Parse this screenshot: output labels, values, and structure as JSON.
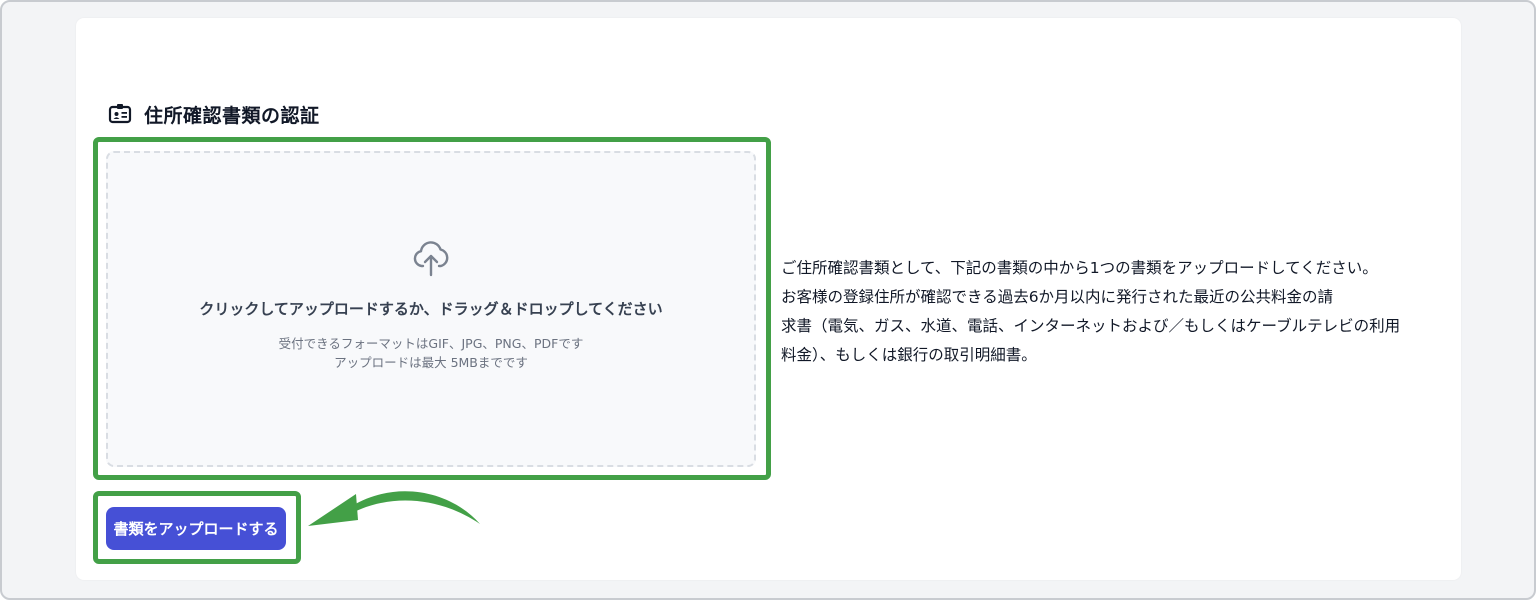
{
  "section": {
    "icon": "id-card-icon",
    "title": "住所確認書類の認証"
  },
  "dropzone": {
    "icon": "cloud-upload-icon",
    "main_text": "クリックしてアップロードするか、ドラッグ＆ドロップしてください",
    "formats_text": "受付できるフォーマットはGIF、JPG、PNG、PDFです",
    "size_text": "アップロードは最大 5MBまでです"
  },
  "upload_button": {
    "label": "書類をアップロードする"
  },
  "description": {
    "lines": [
      "ご住所確認書類として、下記の書類の中から1つの書類をアップロードしてください。",
      "お客様の登録住所が確認できる過去6か月以内に発行された最近の公共料金の請",
      "求書（電気、ガス、水道、電話、インターネットおよび／もしくはケーブルテレビの利用",
      "料金）、もしくは銀行の取引明細書。"
    ]
  },
  "colors": {
    "highlight": "#43a047",
    "button": "#4650d6",
    "arrow": "#43a047"
  }
}
